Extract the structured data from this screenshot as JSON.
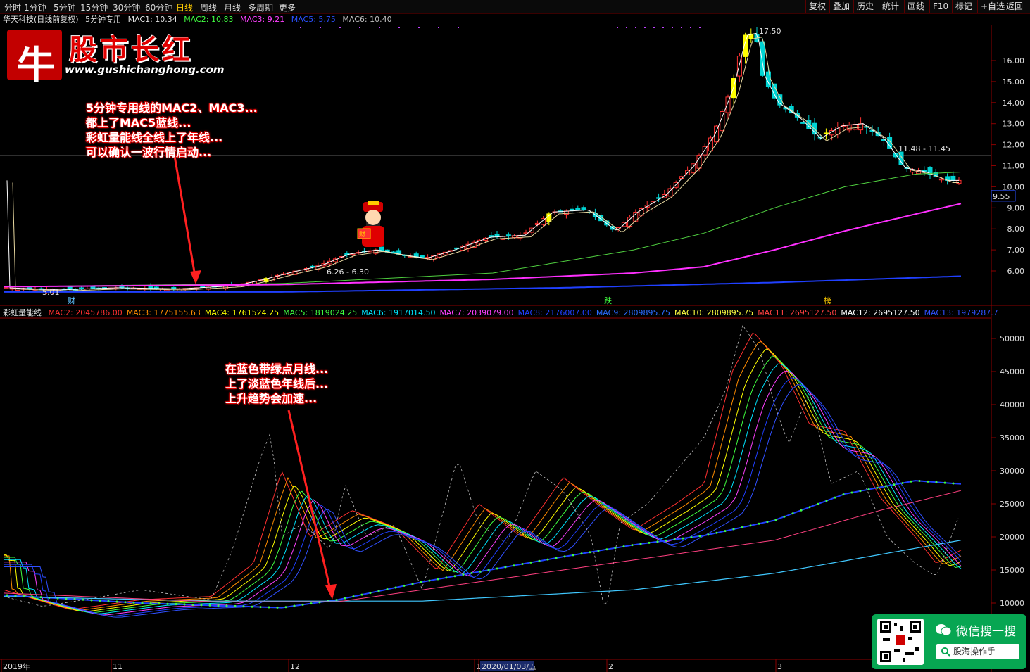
{
  "toolbar": {
    "tabs": [
      "分时",
      "1分钟",
      "5分钟",
      "15分钟",
      "30分钟",
      "60分钟",
      "日线",
      "周线",
      "月线",
      "多周期",
      "更多"
    ],
    "active_tab": "日线",
    "right_buttons": [
      "复权",
      "叠加",
      "历史",
      "统计",
      "画线",
      "F10",
      "标记",
      "+自选",
      "返回"
    ]
  },
  "main_info": {
    "stock": "华天科技(日线前复权)",
    "indicator": "5分钟专用",
    "mac1": "MAC1: 10.34",
    "mac2": "MAC2: 10.83",
    "mac3": "MAC3: 9.21",
    "mac5": "MAC5: 5.75",
    "mac6": "MAC6: 10.40"
  },
  "lower_info": {
    "indicator": "彩虹量能线",
    "items": [
      {
        "label": "MAC2: 2045786.00",
        "color": "#ff3030"
      },
      {
        "label": "MAC3: 1775155.63",
        "color": "#ff8c00"
      },
      {
        "label": "MAC4: 1761524.25",
        "color": "#ffff00"
      },
      {
        "label": "MAC5: 1819024.25",
        "color": "#40ff40"
      },
      {
        "label": "MAC6: 1917014.50",
        "color": "#00e5ff"
      },
      {
        "label": "MAC7: 2039079.00",
        "color": "#ff40ff"
      },
      {
        "label": "MAC8: 2176007.00",
        "color": "#2040ff"
      },
      {
        "label": "MAC9: 2809895.75",
        "color": "#2a6bff"
      },
      {
        "label": "MAC10: 2809895.75",
        "color": "#ffff40"
      },
      {
        "label": "MAC11: 2695127.50",
        "color": "#ff4040"
      },
      {
        "label": "MAC12: 2695127.50",
        "color": "#ffffff"
      },
      {
        "label": "MAC13: 1979287.7",
        "color": "#3050ff"
      }
    ]
  },
  "logo": {
    "char": "牛",
    "title": "股市长红",
    "url": "www.gushichanghong.com"
  },
  "price_labels": {
    "high": "17.50",
    "low": "5.01",
    "range1": "6.26 - 6.30",
    "range2": "11.48 - 11.45",
    "current": "9.55"
  },
  "price_axis": [
    "16.00",
    "15.00",
    "14.00",
    "13.00",
    "12.00",
    "11.00",
    "10.00",
    "9.00",
    "8.00",
    "7.00",
    "6.00"
  ],
  "volume_axis": [
    "50000",
    "45000",
    "40000",
    "35000",
    "30000",
    "25000",
    "20000",
    "15000",
    "10000"
  ],
  "markers": {
    "cai": "财",
    "die": "跌",
    "bang": "榜"
  },
  "callout_top": [
    "5分钟专用线的MAC2、MAC3...",
    "都上了MAC5蓝线...",
    "彩虹量能线全线上了年线...",
    "可以确认一波行情启动..."
  ],
  "callout_bottom": [
    "在蓝色带绿点月线...",
    "上了淡蓝色年线后...",
    "上升趋势会加速..."
  ],
  "date_axis": [
    "2019年",
    "11",
    "12",
    "1",
    "2020/01/03/五",
    "2",
    "3"
  ],
  "wechat": {
    "title": "微信搜一搜",
    "search": "股海操作手"
  },
  "colors": {
    "up": "#ff3232",
    "down": "#00d4d4",
    "limit": "#ffff00",
    "bg": "#000000"
  }
}
